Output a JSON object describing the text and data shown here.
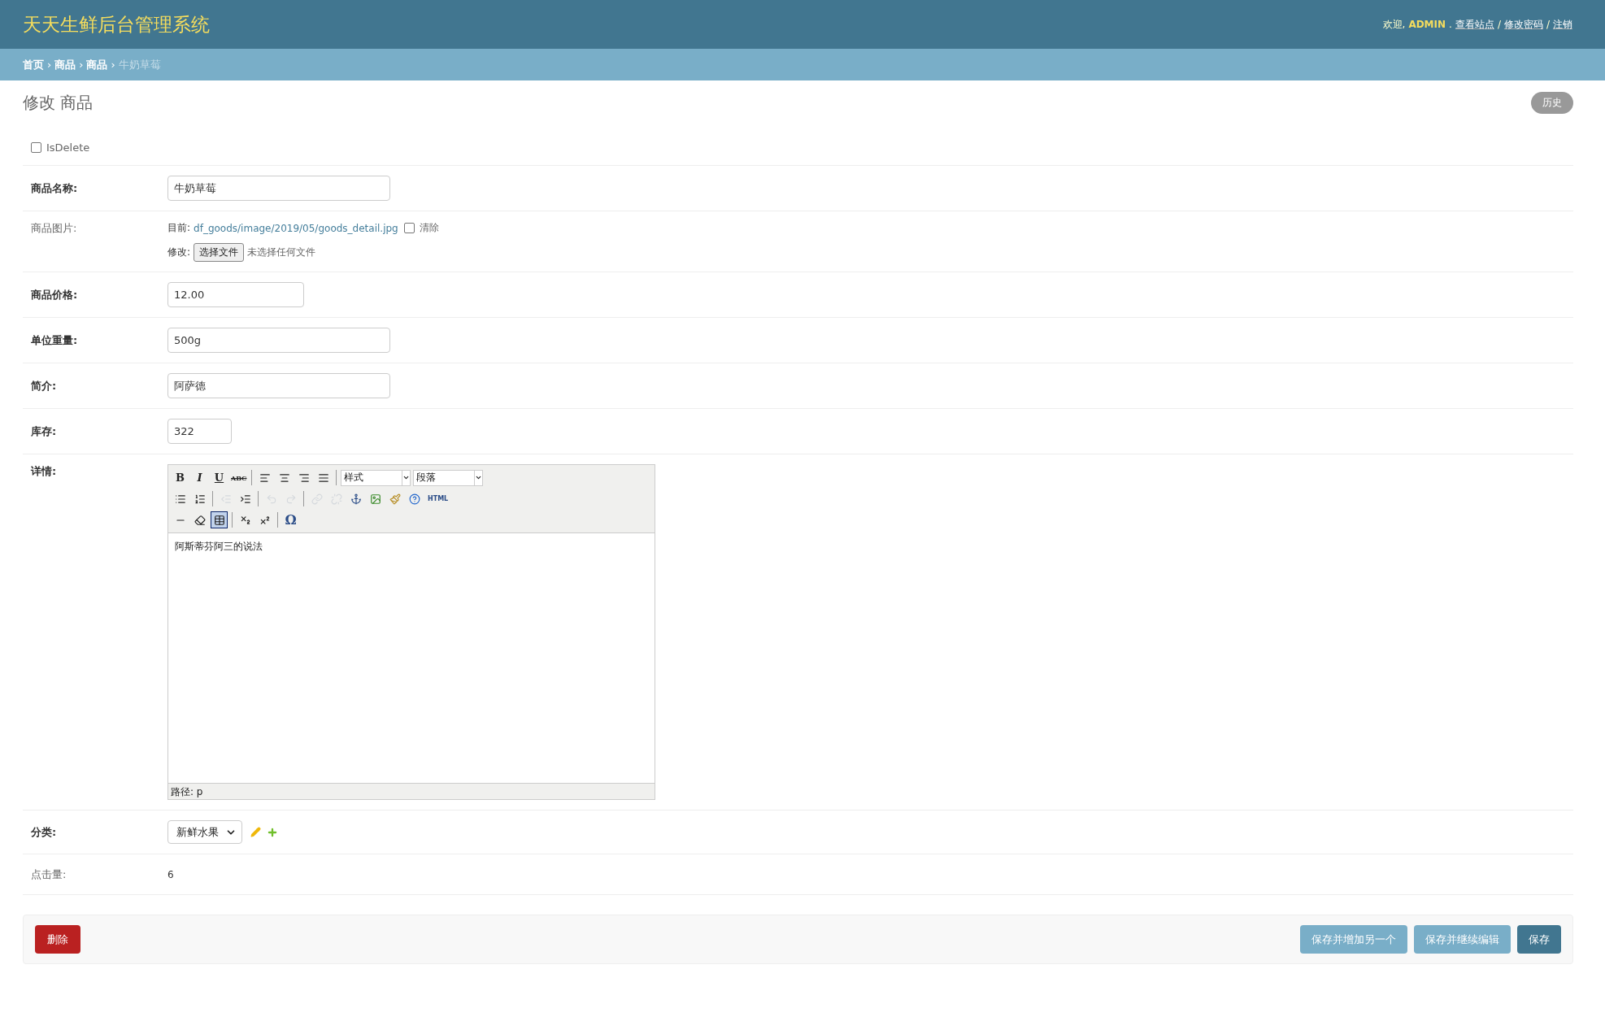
{
  "header": {
    "title": "天天生鲜后台管理系统",
    "user_tools": [
      {
        "kind": "plain",
        "text": "欢迎,"
      },
      {
        "kind": "strong",
        "text": "ADMIN"
      },
      {
        "kind": "plain",
        "text": "."
      },
      {
        "kind": "link",
        "text": "查看站点"
      },
      {
        "kind": "plain",
        "text": "/"
      },
      {
        "kind": "link",
        "text": "修改密码"
      },
      {
        "kind": "plain",
        "text": "/"
      },
      {
        "kind": "link",
        "text": "注销"
      }
    ]
  },
  "breadcrumbs": [
    {
      "kind": "link",
      "text": "首页"
    },
    {
      "kind": "sep",
      "text": "›"
    },
    {
      "kind": "link",
      "text": "商品"
    },
    {
      "kind": "sep",
      "text": "›"
    },
    {
      "kind": "link",
      "text": "商品"
    },
    {
      "kind": "sep",
      "text": "›"
    },
    {
      "kind": "current",
      "text": "牛奶草莓"
    }
  ],
  "page": {
    "title": "修改 商品",
    "history_button": "历史"
  },
  "form_rows": [
    {
      "kind": "checkbox",
      "label": "IsDelete",
      "checked": false
    },
    {
      "kind": "char_input",
      "label": "商品名称:",
      "required": true,
      "value": "牛奶草莓"
    },
    {
      "kind": "file",
      "label": "商品图片:",
      "required": false,
      "current_label": "目前:",
      "current_link": "df_goods/image/2019/05/goods_detail.jpg",
      "clear_checked": false,
      "clear_label": "清除",
      "change_label": "修改:",
      "choose_button": "选择文件",
      "file_status": "未选择任何文件"
    },
    {
      "kind": "decimal_input",
      "label": "商品价格:",
      "required": true,
      "value": "12.00"
    },
    {
      "kind": "char_input",
      "label": "单位重量:",
      "required": true,
      "value": "500g"
    },
    {
      "kind": "char_input",
      "label": "简介:",
      "required": true,
      "value": "阿萨德"
    },
    {
      "kind": "integer_input",
      "label": "库存:",
      "required": true,
      "value": "322"
    },
    {
      "kind": "editor",
      "label": "详情:",
      "required": true,
      "toolbar": [
        [
          {
            "kind": "text",
            "text": "B",
            "disabled": false,
            "pressed": false
          },
          {
            "kind": "text",
            "text": "I",
            "disabled": false,
            "pressed": false
          },
          {
            "kind": "text",
            "text": "U",
            "disabled": false,
            "pressed": false
          },
          {
            "kind": "text",
            "text": "ABC",
            "disabled": false,
            "pressed": false
          },
          {
            "kind": "sep"
          },
          {
            "kind": "icon",
            "disabled": false,
            "pressed": false
          },
          {
            "kind": "icon",
            "disabled": false,
            "pressed": false
          },
          {
            "kind": "icon",
            "disabled": false,
            "pressed": false
          },
          {
            "kind": "icon",
            "disabled": false,
            "pressed": false
          },
          {
            "kind": "sep"
          },
          {
            "kind": "select",
            "text": "样式"
          },
          {
            "kind": "select",
            "text": "段落"
          }
        ],
        [
          {
            "kind": "icon",
            "disabled": false,
            "pressed": false
          },
          {
            "kind": "icon",
            "disabled": false,
            "pressed": false
          },
          {
            "kind": "sep"
          },
          {
            "kind": "icon",
            "disabled": true,
            "pressed": false
          },
          {
            "kind": "icon",
            "disabled": false,
            "pressed": false
          },
          {
            "kind": "sep"
          },
          {
            "kind": "icon",
            "disabled": true,
            "pressed": false
          },
          {
            "kind": "icon",
            "disabled": true,
            "pressed": false
          },
          {
            "kind": "sep"
          },
          {
            "kind": "icon",
            "disabled": true,
            "pressed": false
          },
          {
            "kind": "icon",
            "disabled": true,
            "pressed": false
          },
          {
            "kind": "icon",
            "disabled": false,
            "pressed": false
          },
          {
            "kind": "icon",
            "disabled": false,
            "pressed": false
          },
          {
            "kind": "icon",
            "disabled": false,
            "pressed": false
          },
          {
            "kind": "icon",
            "disabled": false,
            "pressed": false
          },
          {
            "kind": "text",
            "text": "HTML",
            "disabled": false,
            "pressed": false
          }
        ],
        [
          {
            "kind": "icon",
            "disabled": false,
            "pressed": false
          },
          {
            "kind": "icon",
            "disabled": false,
            "pressed": false
          },
          {
            "kind": "icon",
            "disabled": false,
            "pressed": true
          },
          {
            "kind": "sep"
          },
          {
            "kind": "icon",
            "disabled": false,
            "pressed": false
          },
          {
            "kind": "icon",
            "disabled": false,
            "pressed": false
          },
          {
            "kind": "sep"
          },
          {
            "kind": "text",
            "text": "Ω",
            "disabled": false,
            "pressed": false
          }
        ]
      ],
      "content": "阿斯蒂芬阿三的说法",
      "path": "路径: p"
    },
    {
      "kind": "select",
      "label": "分类:",
      "required": true,
      "value": "新鲜水果"
    },
    {
      "kind": "readonly",
      "label": "点击量:",
      "required": false,
      "value": "6"
    }
  ],
  "submit_row": {
    "delete_button": "删除",
    "buttons": [
      {
        "kind": "secondary",
        "text": "保存并增加另一个"
      },
      {
        "kind": "secondary",
        "text": "保存并继续编辑"
      },
      {
        "kind": "primary",
        "text": "保存"
      }
    ]
  }
}
